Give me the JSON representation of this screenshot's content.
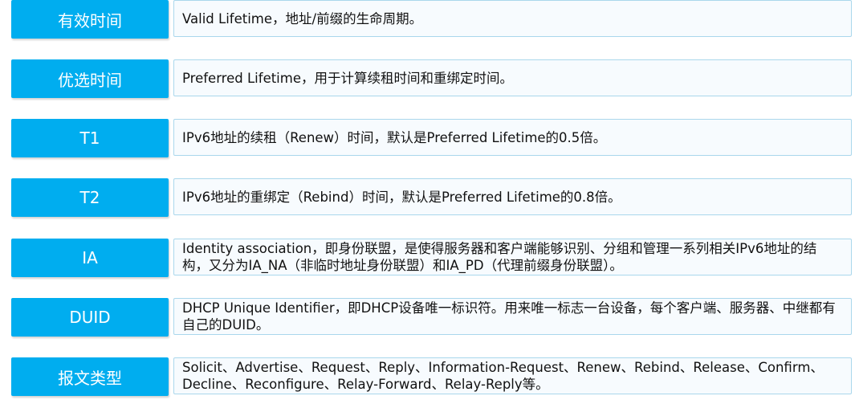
{
  "rows": [
    {
      "term": "有效时间",
      "desc": "Valid Lifetime，地址/前缀的生命周期。"
    },
    {
      "term": "优选时间",
      "desc": "Preferred Lifetime，用于计算续租时间和重绑定时间。"
    },
    {
      "term": "T1",
      "desc": "IPv6地址的续租（Renew）时间，默认是Preferred Lifetime的0.5倍。"
    },
    {
      "term": "T2",
      "desc": "IPv6地址的重绑定（Rebind）时间，默认是Preferred Lifetime的0.8倍。"
    },
    {
      "term": "IA",
      "desc": "Identity association，即身份联盟，是使得服务器和客户端能够识别、分组和管理一系列相关IPv6地址的结构，又分为IA_NA（非临时地址身份联盟）和IA_PD（代理前缀身份联盟）。"
    },
    {
      "term": "DUID",
      "desc": "DHCP Unique Identifier，即DHCP设备唯一标识符。用来唯一标志一台设备，每个客户端、服务器、中继都有自己的DUID。"
    },
    {
      "term": "报文类型",
      "desc": "Solicit、Advertise、Request、Reply、Information-Request、Renew、Rebind、Release、Confirm、Decline、Reconfigure、Relay-Forward、Relay-Reply等。"
    }
  ]
}
